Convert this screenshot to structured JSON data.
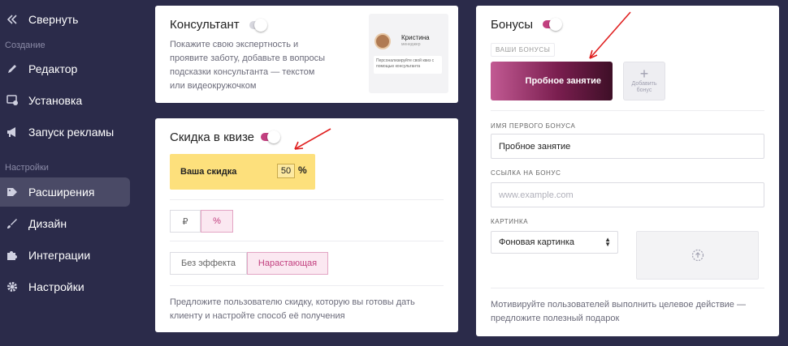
{
  "sidebar": {
    "collapse_label": "Свернуть",
    "section_create": "Создание",
    "section_settings": "Настройки",
    "items": [
      {
        "label": "Редактор",
        "icon": "pencil-icon"
      },
      {
        "label": "Установка",
        "icon": "install-icon"
      },
      {
        "label": "Запуск рекламы",
        "icon": "megaphone-icon"
      },
      {
        "label": "Расширения",
        "icon": "extensions-icon",
        "active": true
      },
      {
        "label": "Дизайн",
        "icon": "brush-icon"
      },
      {
        "label": "Интеграции",
        "icon": "puzzle-icon"
      },
      {
        "label": "Настройки",
        "icon": "gear-icon"
      }
    ]
  },
  "consultant": {
    "title": "Консультант",
    "enabled": false,
    "description": "Покажите свою экспертность и проявите заботу, добавьте в вопросы подсказки консультанта — текстом или видеокружочком",
    "preview": {
      "name": "Кристина",
      "role": "менеджер",
      "message": "Персонализируйте свой квиз с помощью консультанта"
    }
  },
  "discount": {
    "title": "Скидка в квизе",
    "enabled": true,
    "label": "Ваша скидка",
    "value": "50",
    "unit": "%",
    "currency_options": [
      "₽",
      "%"
    ],
    "currency_selected": "%",
    "effect_options": [
      "Без эффекта",
      "Нарастающая"
    ],
    "effect_selected": "Нарастающая",
    "hint": "Предложите пользователю скидку, которую вы готовы дать клиенту и настройте способ её получения"
  },
  "bonuses": {
    "title": "Бонусы",
    "enabled": true,
    "tag": "ВАШИ БОНУСЫ",
    "bonus_tile": "Пробное занятие",
    "add_label_1": "Добавить",
    "add_label_2": "бонус",
    "name_label": "ИМЯ ПЕРВОГО БОНУСА",
    "name_value": "Пробное занятие",
    "link_label": "ССЫЛКА НА БОНУС",
    "link_placeholder": "www.example.com",
    "image_label": "КАРТИНКА",
    "image_select": "Фоновая картинка",
    "footer": "Мотивируйте пользователей выполнить целевое действие — предложите полезный подарок"
  },
  "colors": {
    "accent": "#c2407f",
    "sidebar_bg": "#2b2b4a",
    "discount_bg": "#fde07c",
    "annotation_arrow": "#e02020"
  }
}
